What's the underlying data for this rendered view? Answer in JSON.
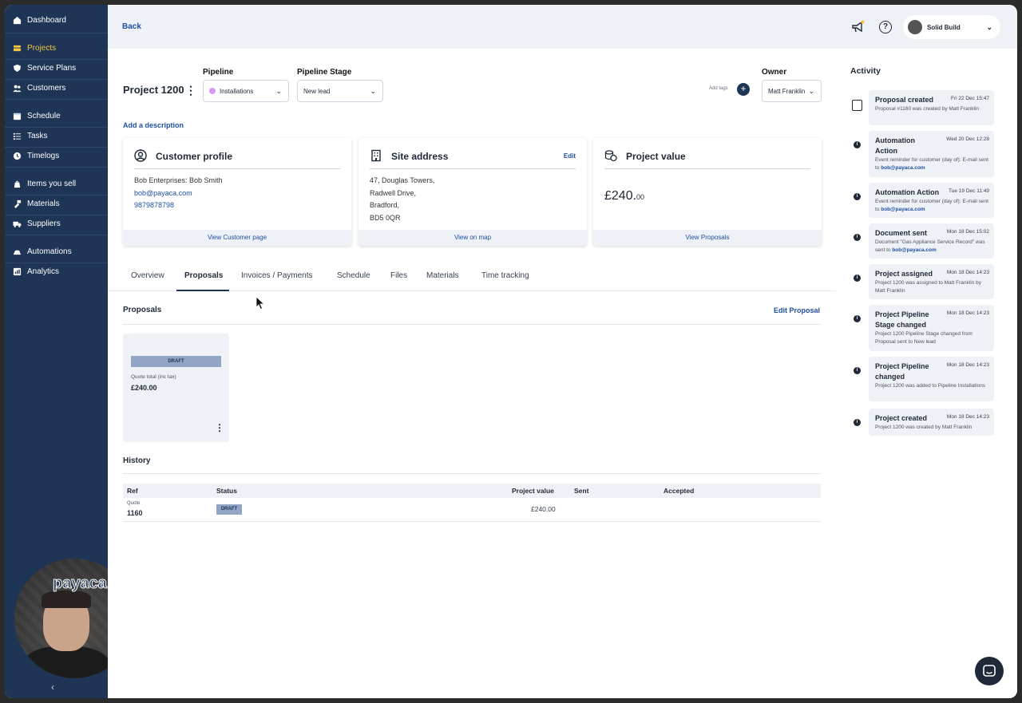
{
  "sidebar": {
    "items": [
      {
        "label": "Dashboard",
        "icon": "home-icon"
      },
      {
        "label": "Projects",
        "icon": "projects-icon",
        "active": true
      },
      {
        "label": "Service Plans",
        "icon": "shield-icon"
      },
      {
        "label": "Customers",
        "icon": "users-icon"
      },
      {
        "label": "Schedule",
        "icon": "calendar-icon"
      },
      {
        "label": "Tasks",
        "icon": "list-icon"
      },
      {
        "label": "Timelogs",
        "icon": "clock-icon"
      },
      {
        "label": "Items you sell",
        "icon": "tag-icon"
      },
      {
        "label": "Materials",
        "icon": "materials-icon"
      },
      {
        "label": "Suppliers",
        "icon": "truck-icon"
      },
      {
        "label": "Automations",
        "icon": "automation-icon"
      },
      {
        "label": "Analytics",
        "icon": "chart-icon"
      }
    ],
    "collapse_glyph": "‹"
  },
  "video": {
    "logo_text": "payaca"
  },
  "topbar": {
    "back_label": "Back",
    "account_name": "Solid Build"
  },
  "project": {
    "title": "Project 1200",
    "pipeline_label": "Pipeline",
    "pipeline_value": "Installations",
    "stage_label": "Pipeline Stage",
    "stage_value": "New lead",
    "add_tags": "Add tags",
    "owner_label": "Owner",
    "owner_value": "Matt Franklin",
    "add_description": "Add a description"
  },
  "cards": {
    "customer": {
      "title": "Customer profile",
      "name": "Bob Enterprises: Bob Smith",
      "email": "bob@payaca.com",
      "phone": "9879878798",
      "footer": "View Customer page"
    },
    "site": {
      "title": "Site address",
      "edit": "Edit",
      "lines": [
        "47, Douglas Towers,",
        "Radwell Drive,",
        "Bradford,",
        "BD5 0QR"
      ],
      "footer": "View on map"
    },
    "value": {
      "title": "Project value",
      "amount_main": "£240.",
      "amount_pence": "00",
      "footer": "View Proposals"
    }
  },
  "tabs": [
    "Overview",
    "Proposals",
    "Invoices / Payments",
    "Schedule",
    "Files",
    "Materials",
    "Time tracking"
  ],
  "proposals": {
    "title": "Proposals",
    "edit_label": "Edit Proposal",
    "card": {
      "badge": "DRAFT",
      "total_label": "Quote total (inc tax)",
      "total_value": "£240.00"
    }
  },
  "history": {
    "title": "History",
    "columns": [
      "Ref",
      "Status",
      "Project value",
      "Sent",
      "Accepted"
    ],
    "rows": [
      {
        "type": "Quote",
        "ref": "1160",
        "status": "DRAFT",
        "value": "£240.00",
        "sent": "",
        "accepted": ""
      }
    ]
  },
  "activity": {
    "title": "Activity",
    "items": [
      {
        "name": "Proposal created",
        "date": "Fri 22 Dec 15:47",
        "desc": "Proposal #1160 was created by Matt Franklin",
        "link": ""
      },
      {
        "name": "Automation Action",
        "date": "Wed 20 Dec 12:28",
        "desc": "Event reminder for customer (day of): E-mail sent to",
        "link": "bob@payaca.com"
      },
      {
        "name": "Automation Action",
        "date": "Tue 19 Dec 11:49",
        "desc": "Event reminder for customer (day of): E-mail sent to",
        "link": "bob@payaca.com"
      },
      {
        "name": "Document sent",
        "date": "Mon 18 Dec 15:02",
        "desc": "Document \"Gas Appliance Service Record\" was sent to",
        "link": "bob@payaca.com"
      },
      {
        "name": "Project assigned",
        "date": "Mon 18 Dec 14:23",
        "desc": "Project 1200 was assigned to Matt Franklin by Matt Franklin",
        "link": ""
      },
      {
        "name": "Project Pipeline Stage changed",
        "date": "Mon 18 Dec 14:23",
        "desc": "Project 1200 Pipeline Stage changed from Proposal sent to New lead",
        "link": ""
      },
      {
        "name": "Project Pipeline changed",
        "date": "Mon 18 Dec 14:23",
        "desc": "Project 1200 was added to Pipeline Installations",
        "link": ""
      },
      {
        "name": "Project created",
        "date": "Mon 18 Dec 14:23",
        "desc": "Project 1200 was created by Matt Franklin",
        "link": ""
      }
    ]
  }
}
